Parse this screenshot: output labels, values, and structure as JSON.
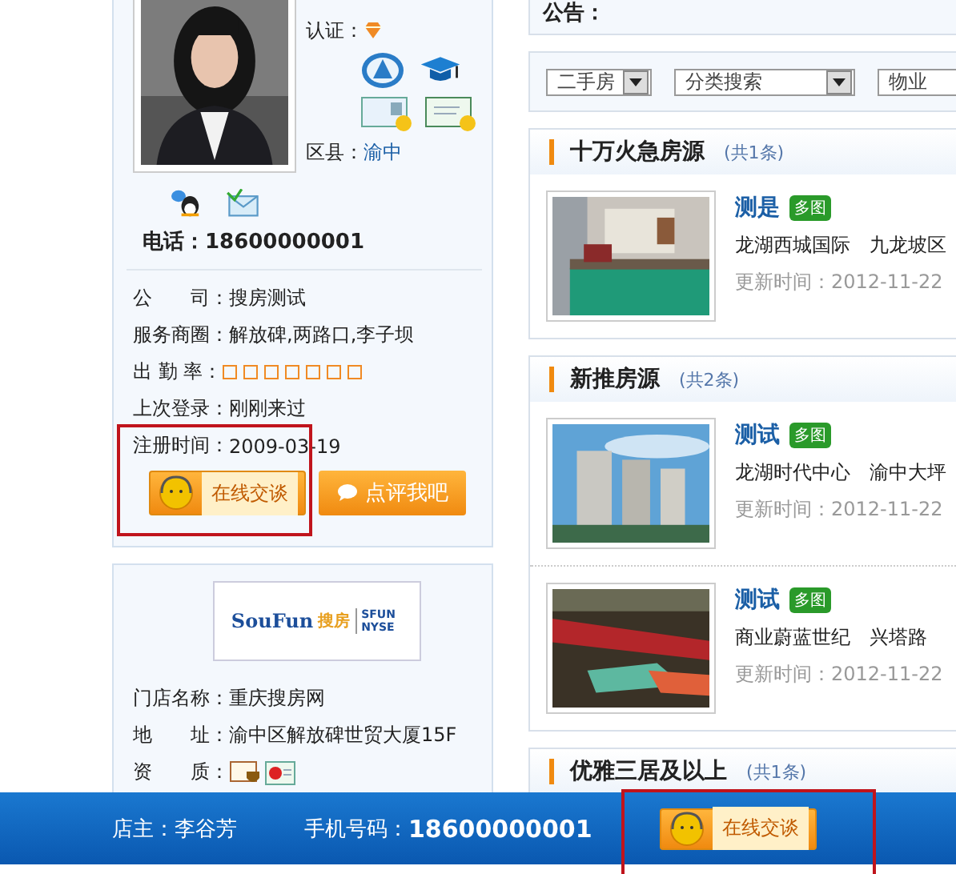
{
  "agent": {
    "certification_label": "认证：",
    "district_label": "区县：",
    "district": "渝中",
    "phone_label": "电话：",
    "phone": "18600000001",
    "details": [
      {
        "kind": "text",
        "label": "公　　司：",
        "value": "搜房测试"
      },
      {
        "kind": "text",
        "label": "服务商圈：",
        "value": "解放碑,两路口,李子坝"
      },
      {
        "kind": "rating",
        "label": "出 勤 率：",
        "stars": 0
      },
      {
        "kind": "text",
        "label": "上次登录：",
        "value": "刚刚来过"
      },
      {
        "kind": "text",
        "label": "注册时间：",
        "value": "2009-03-19"
      }
    ],
    "chat_button": "在线交谈",
    "review_button": "点评我吧"
  },
  "store": {
    "logo_cn": "搜房",
    "logo_en": "SouFun",
    "logo_ticker": "SFUN NYSE",
    "details": [
      {
        "kind": "text",
        "label": "门店名称：",
        "value": "重庆搜房网"
      },
      {
        "kind": "text",
        "label": "地　　址：",
        "value": "渝中区解放碑世贸大厦15F"
      },
      {
        "kind": "icons",
        "label": "资　　质："
      }
    ]
  },
  "notice": {
    "label": "公告："
  },
  "filters": [
    {
      "value": "二手房",
      "kind": "short"
    },
    {
      "value": "分类搜索",
      "kind": "long"
    },
    {
      "value": "物业",
      "kind": "cut"
    }
  ],
  "sections": [
    {
      "title": "十万火急房源",
      "count": "(共1条)",
      "listings": [
        {
          "title": "测是",
          "badge": "多图",
          "estate": "龙湖西城国际",
          "area": "九龙坡区",
          "updated_label": "更新时间：",
          "updated": "2012-11-22"
        }
      ]
    },
    {
      "title": "新推房源",
      "count": "(共2条)",
      "listings": [
        {
          "title": "测试",
          "badge": "多图",
          "estate": "龙湖时代中心",
          "area": "渝中大坪",
          "updated_label": "更新时间：",
          "updated": "2012-11-22"
        },
        {
          "title": "测试",
          "badge": "多图",
          "estate": "商业蔚蓝世纪",
          "area": "兴塔路",
          "updated_label": "更新时间：",
          "updated": "2012-11-22"
        }
      ]
    },
    {
      "title": "优雅三居及以上",
      "count": "(共1条)"
    }
  ],
  "bottom_bar": {
    "owner": "店主：李谷芳",
    "phone_label": "手机号码：",
    "phone": "18600000001",
    "chat_button": "在线交谈"
  }
}
